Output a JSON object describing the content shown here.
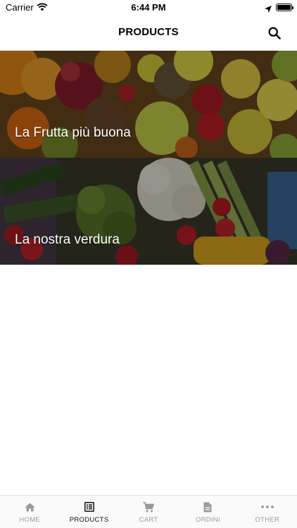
{
  "status_bar": {
    "carrier": "Carrier",
    "time": "6:44 PM"
  },
  "nav": {
    "title": "PRODUCTS",
    "search_icon": "search-icon"
  },
  "categories": [
    {
      "label": "La Frutta più buona",
      "image": "fruit-photo"
    },
    {
      "label": "La nostra verdura",
      "image": "vegetables-photo"
    }
  ],
  "tabs": [
    {
      "label": "HOME",
      "icon": "home-icon",
      "active": false
    },
    {
      "label": "PRODUCTS",
      "icon": "list-icon",
      "active": true
    },
    {
      "label": "CART",
      "icon": "cart-icon",
      "active": false
    },
    {
      "label": "ORDINI",
      "icon": "document-icon",
      "active": false
    },
    {
      "label": "OTHER",
      "icon": "more-icon",
      "active": false
    }
  ],
  "colors": {
    "active_tab": "#111111",
    "inactive_tab": "#9a9a9a",
    "overlay_text": "#ffffff"
  }
}
